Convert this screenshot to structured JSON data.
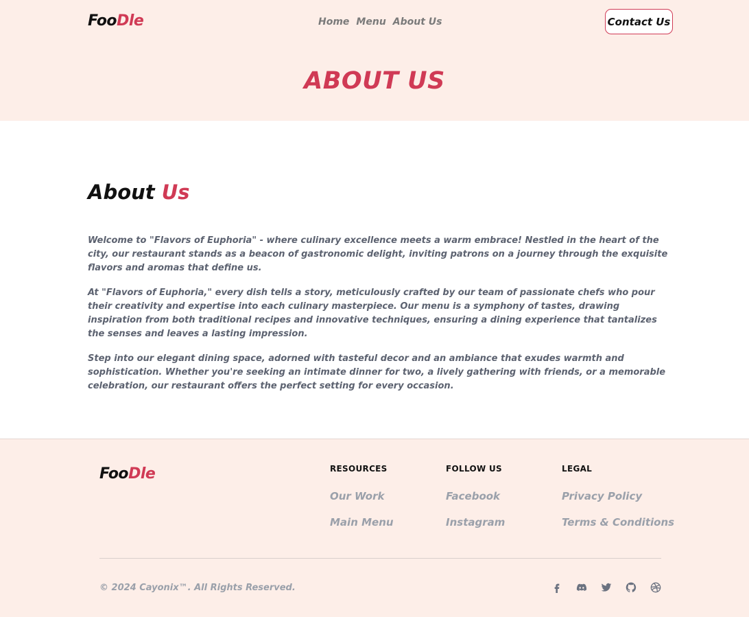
{
  "header": {
    "logo_part1": "Foo",
    "logo_part2": "Dle",
    "nav": [
      "Home",
      "Menu",
      "About Us"
    ],
    "contact_label": "Contact Us",
    "hero_title": "ABOUT US"
  },
  "main": {
    "heading_part1": "About",
    "heading_part2": "Us",
    "paragraphs": [
      "Welcome to \"Flavors of Euphoria\" - where culinary excellence meets a warm embrace! Nestled in the heart of the city, our restaurant stands as a beacon of gastronomic delight, inviting patrons on a journey through the exquisite flavors and aromas that define us.",
      "At \"Flavors of Euphoria,\" every dish tells a story, meticulously crafted by our team of passionate chefs who pour their creativity and expertise into each culinary masterpiece. Our menu is a symphony of tastes, drawing inspiration from both traditional recipes and innovative techniques, ensuring a dining experience that tantalizes the senses and leaves a lasting impression.",
      "Step into our elegant dining space, adorned with tasteful decor and an ambiance that exudes warmth and sophistication. Whether you're seeking an intimate dinner for two, a lively gathering with friends, or a memorable celebration, our restaurant offers the perfect setting for every occasion."
    ]
  },
  "footer": {
    "logo_part1": "Foo",
    "logo_part2": "Dle",
    "resources": {
      "title": "RESOURCES",
      "links": [
        "Our Work",
        "Main Menu"
      ]
    },
    "follow": {
      "title": "FOLLOW US",
      "links": [
        "Facebook",
        "Instagram"
      ]
    },
    "legal": {
      "title": "LEGAL",
      "links": [
        "Privacy Policy",
        "Terms & Conditions"
      ]
    },
    "copyright": "© 2024 Cayonix™. All Rights Reserved.",
    "social_icons": [
      "facebook-icon",
      "discord-icon",
      "twitter-icon",
      "github-icon",
      "dribbble-icon"
    ]
  },
  "colors": {
    "accent": "#d03a55",
    "header_bg": "#fdeee8",
    "muted_text": "#9aa0aa"
  }
}
